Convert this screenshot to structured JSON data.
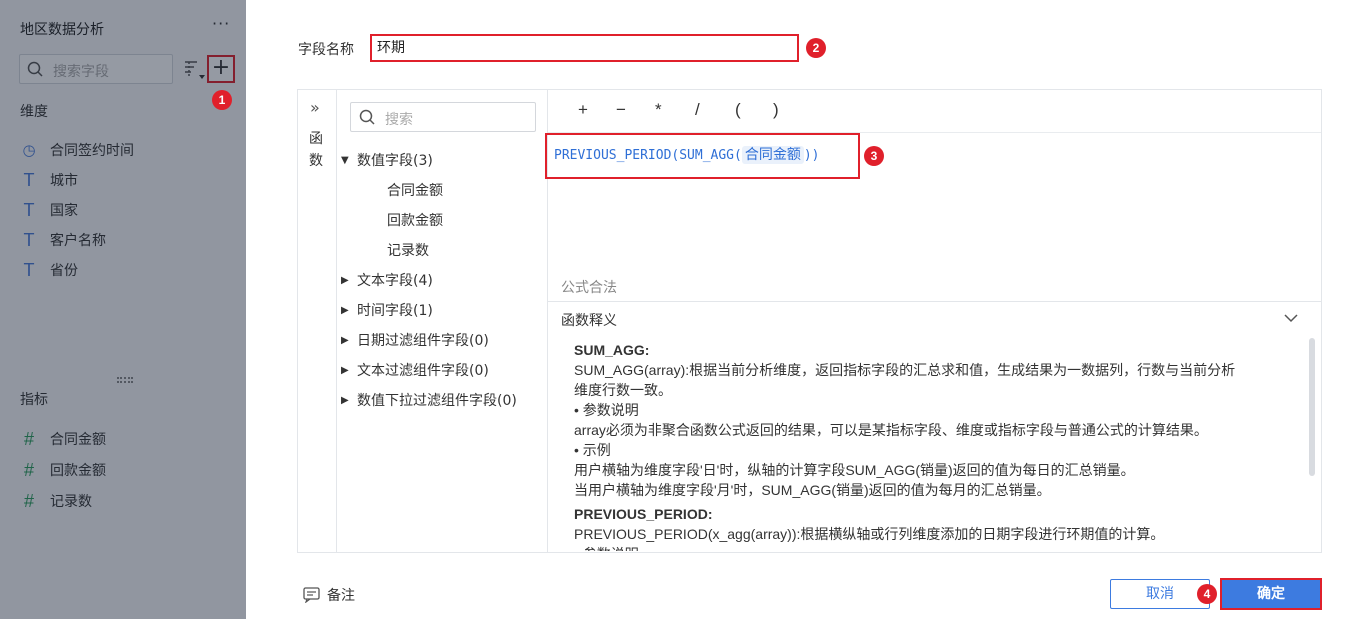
{
  "left_panel": {
    "title": "地区数据分析",
    "more": "···",
    "search_placeholder": "搜索字段",
    "add_button": "+",
    "dimension_label": "维度",
    "dimensions": [
      {
        "icon": "clock-icon",
        "glyph": "◷",
        "label": "合同签约时间"
      },
      {
        "icon": "text-icon",
        "glyph": "T",
        "label": "城市"
      },
      {
        "icon": "text-icon",
        "glyph": "T",
        "label": "国家"
      },
      {
        "icon": "text-icon",
        "glyph": "T",
        "label": "客户名称"
      },
      {
        "icon": "text-icon",
        "glyph": "T",
        "label": "省份"
      }
    ],
    "measure_label": "指标",
    "measures": [
      {
        "icon": "hash-icon",
        "glyph": "#",
        "label": "合同金额"
      },
      {
        "icon": "hash-icon",
        "glyph": "#",
        "label": "回款金额"
      },
      {
        "icon": "hash-calc-icon",
        "glyph": "#",
        "label": "记录数"
      }
    ]
  },
  "badges": [
    "1",
    "2",
    "3",
    "4"
  ],
  "form": {
    "field_name_label": "字段名称",
    "field_name_value": "环期"
  },
  "function_panel": {
    "collapse_glyph": "»",
    "label": "函数"
  },
  "fields_panel": {
    "search_placeholder": "搜索",
    "groups": [
      {
        "label": "数值字段(3)",
        "expanded": true,
        "children": [
          "合同金额",
          "回款金额",
          "记录数"
        ]
      },
      {
        "label": "文本字段(4)",
        "expanded": false
      },
      {
        "label": "时间字段(1)",
        "expanded": false
      },
      {
        "label": "日期过滤组件字段(0)",
        "expanded": false
      },
      {
        "label": "文本过滤组件字段(0)",
        "expanded": false
      },
      {
        "label": "数值下拉过滤组件字段(0)",
        "expanded": false
      }
    ]
  },
  "editor": {
    "operators": [
      "+",
      "−",
      "*",
      "/",
      "(",
      ")"
    ],
    "formula_prefix": "PREVIOUS_PERIOD(SUM_AGG(",
    "formula_field": "合同金额",
    "formula_suffix": "))",
    "validity": "公式合法",
    "desc_title": "函数释义",
    "desc_lines": [
      {
        "type": "h",
        "text": "SUM_AGG:"
      },
      {
        "type": "p",
        "text": "SUM_AGG(array):根据当前分析维度，返回指标字段的汇总求和值，生成结果为一数据列，行数与当前分析"
      },
      {
        "type": "p",
        "text": "维度行数一致。"
      },
      {
        "type": "p",
        "text": "• 参数说明"
      },
      {
        "type": "p",
        "text": "array必须为非聚合函数公式返回的结果，可以是某指标字段、维度或指标字段与普通公式的计算结果。"
      },
      {
        "type": "p",
        "text": "• 示例"
      },
      {
        "type": "p",
        "text": "用户横轴为维度字段'日'时，纵轴的计算字段SUM_AGG(销量)返回的值为每日的汇总销量。"
      },
      {
        "type": "p",
        "text": "当用户横轴为维度字段'月'时，SUM_AGG(销量)返回的值为每月的汇总销量。"
      },
      {
        "type": "h",
        "text": "PREVIOUS_PERIOD:"
      },
      {
        "type": "p",
        "text": "PREVIOUS_PERIOD(x_agg(array)):根据横纵轴或行列维度添加的日期字段进行环期值的计算。"
      },
      {
        "type": "p",
        "text": "• 参数说明"
      }
    ]
  },
  "footer": {
    "note_label": "备注",
    "cancel_label": "取消",
    "ok_label": "确定"
  },
  "colors": {
    "highlight": "#e0202b",
    "primary": "#3d7be0"
  }
}
